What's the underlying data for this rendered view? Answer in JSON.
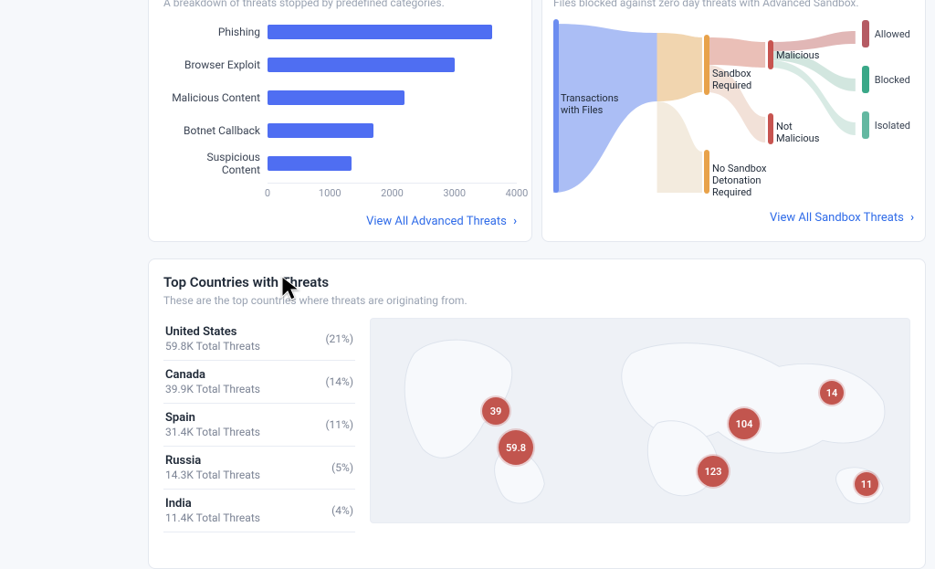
{
  "threats_card": {
    "subtitle": "A breakdown of threats stopped by predefined categories.",
    "link_label": "View All Advanced Threats"
  },
  "sandbox_card": {
    "subtitle": "Files blocked against zero day threats with Advanced Sandbox.",
    "link_label": "View All Sandbox Threats",
    "stage1": "Transactions with Files",
    "stage2a": "Sandbox Required",
    "stage2b": "No Sandbox Detonation Required",
    "stage3a": "Malicious",
    "stage3b": "Not Malicious",
    "outcomes": [
      "Allowed",
      "Blocked",
      "Isolated"
    ]
  },
  "countries_card": {
    "title": "Top Countries with Threats",
    "subtitle": "These are the top countries where threats are originating from.",
    "rows": [
      {
        "name": "United States",
        "total": "59.8K Total Threats",
        "pct": "(21%)"
      },
      {
        "name": "Canada",
        "total": "39.9K Total Threats",
        "pct": "(14%)"
      },
      {
        "name": "Spain",
        "total": "31.4K Total Threats",
        "pct": "(11%)"
      },
      {
        "name": "Russia",
        "total": "14.3K Total Threats",
        "pct": "(5%)"
      },
      {
        "name": "India",
        "total": "11.4K Total Threats",
        "pct": "(4%)"
      }
    ],
    "bubbles": [
      "39",
      "59.8",
      "104",
      "123",
      "14",
      "11"
    ]
  },
  "chart_data": {
    "type": "bar",
    "orientation": "horizontal",
    "categories": [
      "Phishing",
      "Browser Exploit",
      "Malicious Content",
      "Botnet Callback",
      "Suspicious Content"
    ],
    "values": [
      3600,
      3000,
      2200,
      1700,
      1350
    ],
    "xlabel": "",
    "ylabel": "",
    "xlim": [
      0,
      4000
    ],
    "ticks": [
      0,
      1000,
      2000,
      3000,
      4000
    ]
  },
  "colors": {
    "bar": "#4f6ef2",
    "link": "#2f6be8",
    "sankey_blue": "#6c8df0",
    "sankey_orange": "#e8a24a",
    "sankey_red": "#c75450",
    "sankey_cream": "#e7d5b8",
    "swatch_allowed": "#b55b63",
    "swatch_blocked": "#3aa888",
    "swatch_isolated": "#63b8a1",
    "bubble": "#c2554e"
  }
}
